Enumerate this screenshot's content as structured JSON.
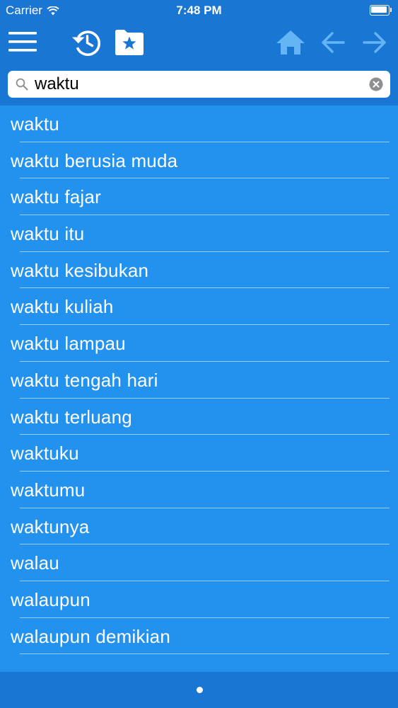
{
  "status_bar": {
    "carrier": "Carrier",
    "time": "7:48 PM"
  },
  "toolbar": {
    "icons": [
      "menu-icon",
      "history-icon",
      "favorites-folder-icon",
      "home-icon",
      "back-arrow-icon",
      "forward-arrow-icon"
    ]
  },
  "search": {
    "value": "waktu",
    "placeholder": ""
  },
  "results": [
    "waktu",
    "waktu berusia muda",
    "waktu fajar",
    "waktu itu",
    "waktu kesibukan",
    "waktu kuliah",
    "waktu lampau",
    "waktu tengah hari",
    "waktu terluang",
    "waktuku",
    "waktumu",
    "waktunya",
    "walau",
    "walaupun",
    "walaupun demikian"
  ],
  "pagination": {
    "pages": 1,
    "current": 1
  },
  "colors": {
    "toolbar": "#1976D2",
    "list": "#2392EE",
    "disabled_icon": "#64B5F6"
  }
}
